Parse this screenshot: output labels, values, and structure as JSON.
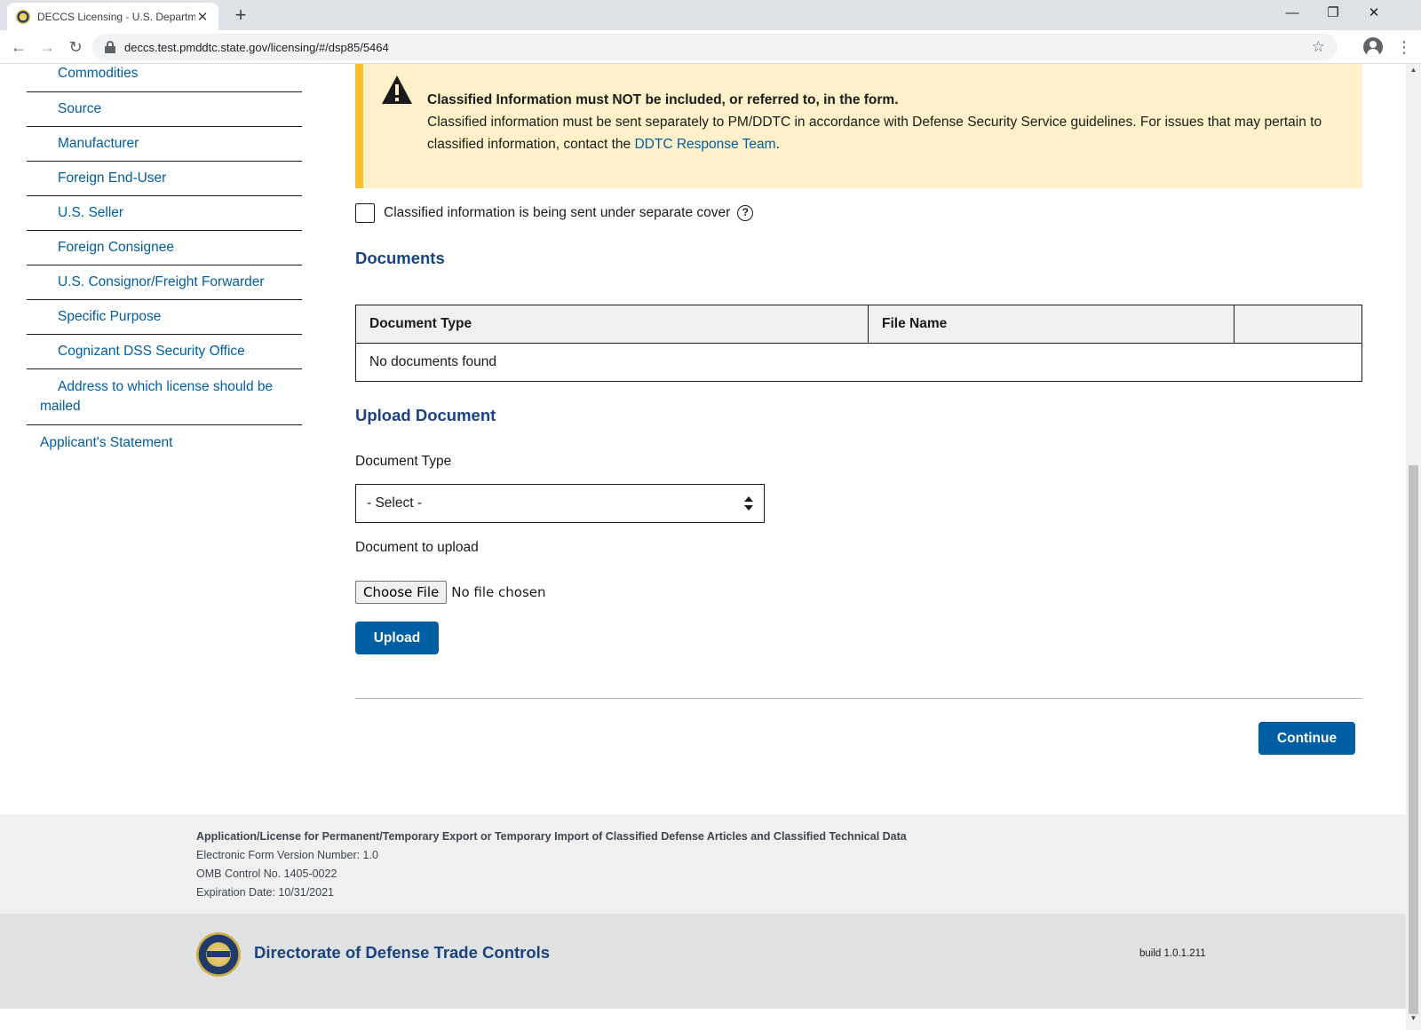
{
  "browser": {
    "tab_title": "DECCS Licensing - U.S. Department",
    "tab_close": "✕",
    "new_tab": "+",
    "url": "deccs.test.pmddtc.state.gov/licensing/#/dsp85/5464",
    "win_minimize": "—",
    "win_restore": "❐",
    "win_close": "✕",
    "back": "←",
    "forward": "→",
    "reload": "↻",
    "star": "☆",
    "menu": "⋮",
    "scroll_up": "▲",
    "scroll_down": "▼"
  },
  "sidebar": {
    "items": [
      "Commodities",
      "Source",
      "Manufacturer",
      "Foreign End-User",
      "U.S. Seller",
      "Foreign Consignee",
      "U.S. Consignor/Freight Forwarder",
      "Specific Purpose",
      "Cognizant DSS Security Office",
      "Address to which license should be mailed"
    ],
    "top_item": "Applicant's Statement"
  },
  "alert": {
    "heading": "Classified Information must NOT be included, or referred to, in the form.",
    "body": "Classified information must be sent separately to PM/DDTC in accordance with Defense Security Service guidelines. For issues that may pertain to classified information, contact the ",
    "link": "DDTC Response Team",
    "tail": "."
  },
  "classified_checkbox": {
    "label": "Classified information is being sent under separate cover",
    "help": "?",
    "checked": false
  },
  "documents": {
    "title": "Documents",
    "columns": [
      "Document Type",
      "File Name",
      ""
    ],
    "empty_message": "No documents found"
  },
  "upload": {
    "title": "Upload Document",
    "type_label": "Document Type",
    "type_value": "- Select -",
    "file_label": "Document to upload",
    "file_button": "Choose File",
    "file_status": "No file chosen",
    "upload_button": "Upload"
  },
  "continue_button": "Continue",
  "footer": {
    "form_title": "Application/License for Permanent/Temporary Export or Temporary Import of Classified Defense Articles and Classified Technical Data",
    "version": "Electronic Form Version Number: 1.0",
    "omb": "OMB Control No. 1405-0022",
    "expiration": "Expiration Date: 10/31/2021",
    "seal_text": "DDTC",
    "brand": "Directorate of Defense Trade Controls",
    "build": "build 1.0.1.211"
  },
  "colors": {
    "link": "#005ea2",
    "heading": "#1a4480",
    "alert_bg": "#fef0c8",
    "alert_border": "#ffbe2e",
    "primary_button": "#005ea2"
  }
}
